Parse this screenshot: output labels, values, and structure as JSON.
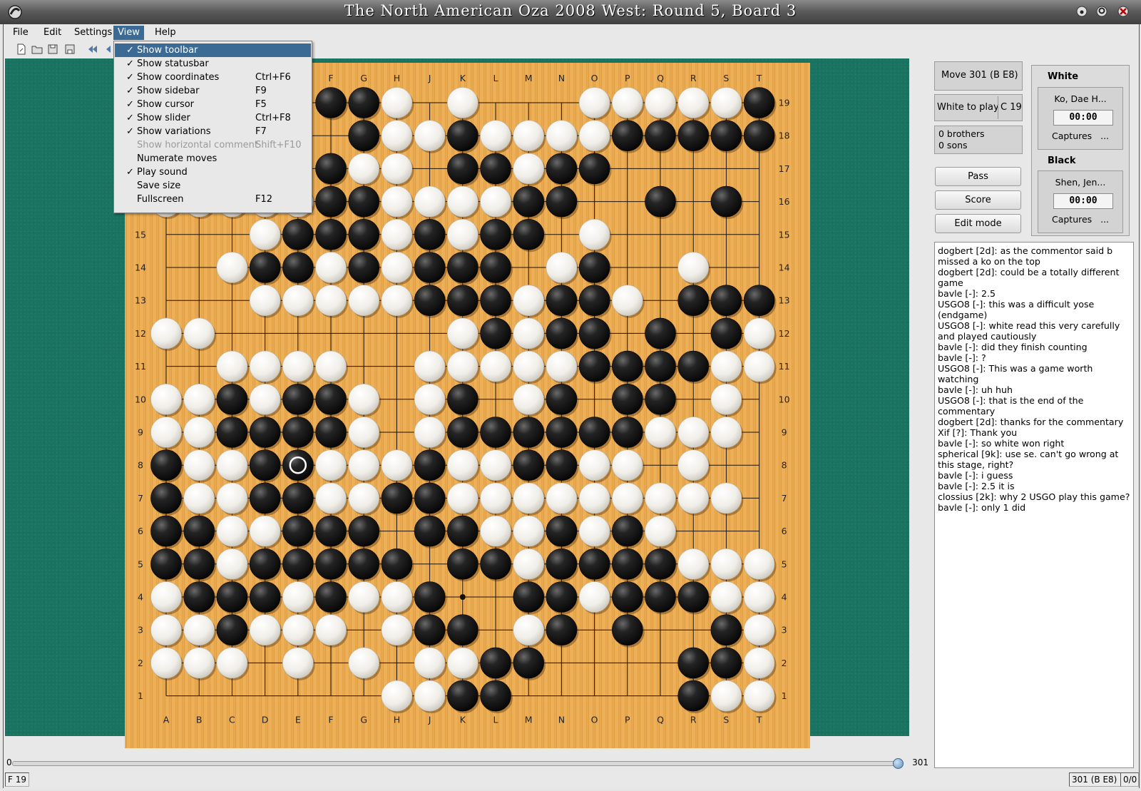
{
  "window": {
    "title": "The North American Oza 2008 West: Round 5, Board 3"
  },
  "menubar": [
    {
      "label": "File"
    },
    {
      "label": "Edit"
    },
    {
      "label": "Settings"
    },
    {
      "label": "View",
      "active": true
    },
    {
      "label": "Help"
    }
  ],
  "view_menu": [
    {
      "label": "Show toolbar",
      "checked": true,
      "accel": "",
      "state": "selected"
    },
    {
      "label": "Show statusbar",
      "checked": true,
      "accel": "",
      "state": ""
    },
    {
      "label": "Show coordinates",
      "checked": true,
      "accel": "Ctrl+F6",
      "state": ""
    },
    {
      "label": "Show sidebar",
      "checked": true,
      "accel": "F9",
      "state": ""
    },
    {
      "label": "Show cursor",
      "checked": true,
      "accel": "F5",
      "state": ""
    },
    {
      "label": "Show slider",
      "checked": true,
      "accel": "Ctrl+F8",
      "state": ""
    },
    {
      "label": "Show variations",
      "checked": true,
      "accel": "F7",
      "state": ""
    },
    {
      "label": "Show horizontal comment",
      "checked": false,
      "accel": "Shift+F10",
      "state": "disabled"
    },
    {
      "label": "Numerate moves",
      "checked": false,
      "accel": "",
      "state": ""
    },
    {
      "label": "Play sound",
      "checked": true,
      "accel": "",
      "state": ""
    },
    {
      "label": "Save size",
      "checked": false,
      "accel": "",
      "state": ""
    },
    {
      "label": "Fullscreen",
      "checked": false,
      "accel": "F12",
      "state": ""
    }
  ],
  "toolbar": {
    "icons": [
      "new-file-icon",
      "open-file-icon",
      "save-icon",
      "save-as-icon",
      "first-move-icon",
      "previous-move-icon",
      "about-icon"
    ]
  },
  "board": {
    "size": 19,
    "columns": [
      "A",
      "B",
      "C",
      "D",
      "E",
      "F",
      "G",
      "H",
      "J",
      "K",
      "L",
      "M",
      "N",
      "O",
      "P",
      "Q",
      "R",
      "S",
      "T"
    ],
    "rows": [
      "19",
      "18",
      "17",
      "16",
      "15",
      "14",
      "13",
      "12",
      "11",
      "10",
      "9",
      "8",
      "7",
      "6",
      "5",
      "4",
      "3",
      "2",
      "1"
    ],
    "hoshi_visible": [
      "K4"
    ],
    "grid_rows_top_to_bottom": [
      "..?..XXO.O...OOOOOX",
      "..?...XOOXOOOOXXXXX",
      "..?..XOO.XXOXX.....",
      "OOOOOXXOOOOXX..X.X.",
      "...OXXXOXOXX.O.....",
      "..OXXOXOXXX.OX..O..",
      "...OOOOOXXXOXXO.XXX",
      "OO.......OXOXX.X.XOX",
      "..OOOO..OOOOOXXXXOO",
      "OOXOXXO.OX.OX.XX.O.O",
      "OOXXXXO.OXXXXXXOOO.",
      "XOOXXOOOXOOXXOO.O..",
      "XOOXXOOXXOOOOOOOOO.",
      "XXOOXXX.XXOOXOXO...",
      "XXOXXXXX.XXOXXXXOOO",
      "OXXXOXOOX..XXOXXXOO",
      "OOXOOO.OXX.OX.X..XO",
      "OOO.O.O.OOXX....XXO",
      ".......OOXX.....XOO"
    ],
    "last_move": "E8",
    "last_move_color": "black"
  },
  "slider": {
    "min_label": "0",
    "max_label": "301",
    "position": 301,
    "max": 301
  },
  "status": {
    "cursor": "F 19",
    "move": "301 (B E8)",
    "variations": "0/0"
  },
  "sidebar": {
    "move_label": "Move 301 (B E8)",
    "to_play": "White to play",
    "coord": "C 19",
    "brothers": "0 brothers",
    "sons": "0 sons",
    "pass_label": "Pass",
    "score_label": "Score",
    "edit_label": "Edit mode",
    "white": {
      "heading": "White",
      "name": "Ko, Dae H...",
      "time": "00:00",
      "captures": "Captures   ..."
    },
    "black": {
      "heading": "Black",
      "name": "Shen, Jen...",
      "time": "00:00",
      "captures": "Captures   ..."
    }
  },
  "chat": [
    "dogbert [2d]: as the commentor said b missed a ko on the top",
    "dogbert [2d]: could be a totally different game",
    "bavle [-]: 2.5",
    "USGO8 [-]: this was a difficult yose (endgame)",
    "USGO8 [-]: white read this very carefully and played cautiously",
    "bavle [-]: did they finish counting",
    "bavle [-]: ?",
    "USGO8 [-]: This was a game worth watching",
    "bavle [-]: uh huh",
    "USGO8 [-]: that is the end of the commentary",
    "dogbert [2d]: thanks for the commentary",
    "Xif [?]: Thank you",
    "bavle [-]: so white won right",
    "spherical [9k]: use se. can't go wrong at this stage, right?",
    "bavle [-]: i guess",
    "bavle [-]: 2.5 it is",
    "clossius [2k]: why 2 USGO play this game?",
    "bavle [-]: only 1 did"
  ],
  "colors": {
    "felt": "#1a7361",
    "board_wood": "#e9a94e",
    "menu_highlight": "#3b6a94"
  }
}
